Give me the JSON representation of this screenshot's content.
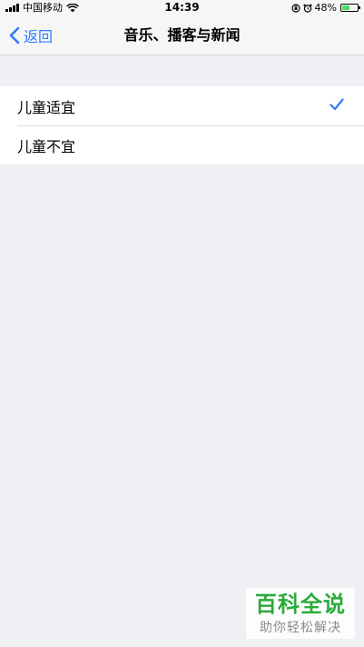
{
  "status_bar": {
    "carrier": "中国移动",
    "time": "14:39",
    "battery_percent": "48%",
    "battery_level": 0.48,
    "icons": [
      "signal-icon",
      "wifi-icon",
      "orientation-lock-icon",
      "alarm-icon",
      "battery-icon"
    ]
  },
  "nav": {
    "back_label": "返回",
    "title": "音乐、播客与新闻"
  },
  "options": [
    {
      "label": "儿童适宜",
      "selected": true
    },
    {
      "label": "儿童不宜",
      "selected": false
    }
  ],
  "colors": {
    "accent": "#2f7cf6",
    "background": "#efeff4",
    "watermark_green": "#2bab3b"
  },
  "watermark": {
    "title": "百科全说",
    "subtitle": "助你轻松解决"
  }
}
